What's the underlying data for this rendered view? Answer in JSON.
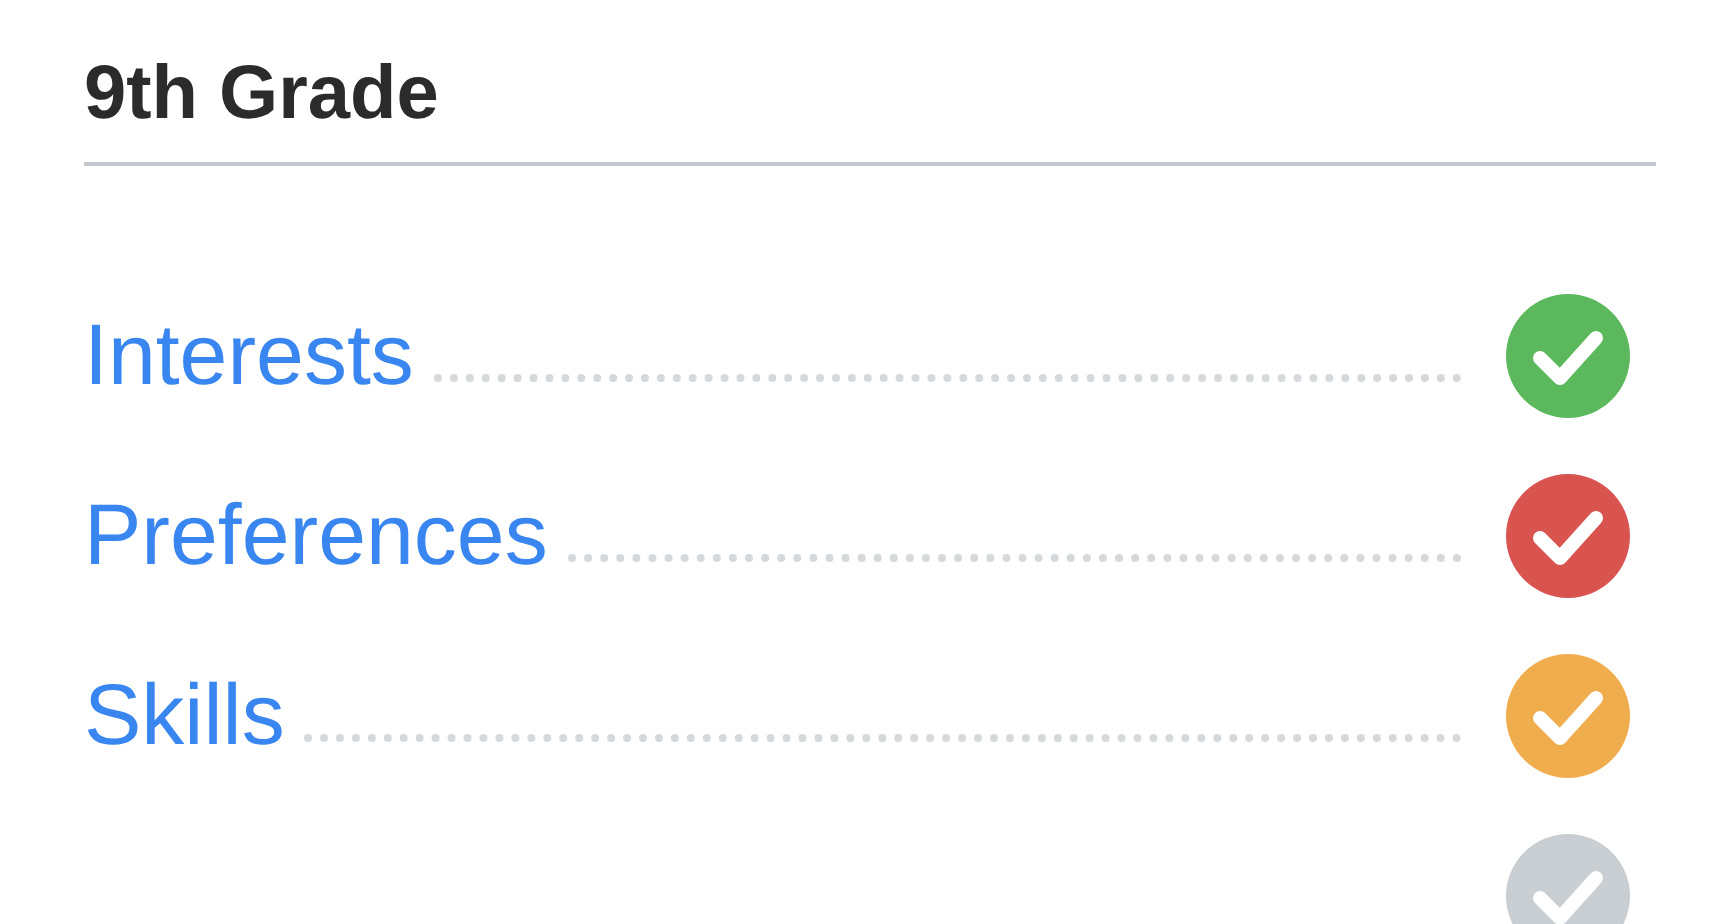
{
  "heading": "9th Grade",
  "items": [
    {
      "label": "Interests",
      "color": "#5cb85c"
    },
    {
      "label": "Preferences",
      "color": "#d9534f"
    },
    {
      "label": "Skills",
      "color": "#f0ad4e"
    },
    {
      "color": "#c9ced3"
    }
  ]
}
